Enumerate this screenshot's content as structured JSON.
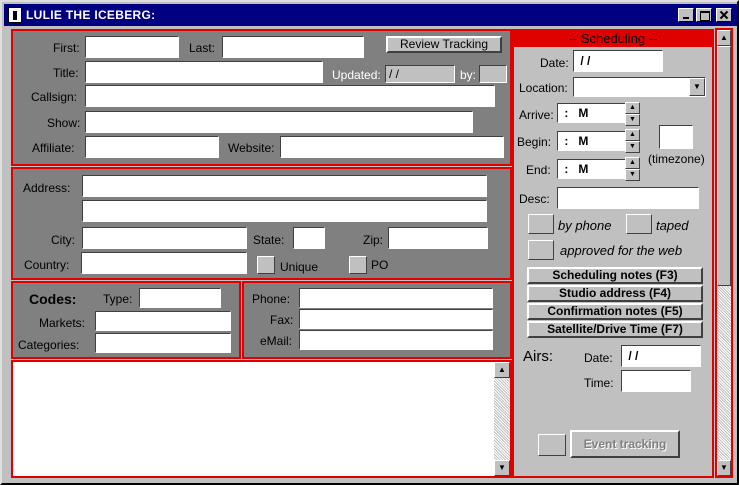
{
  "window": {
    "title": "LULIE THE ICEBERG:"
  },
  "contact": {
    "first_label": "First:",
    "first_value": "",
    "last_label": "Last:",
    "last_value": "",
    "review_button": "Review Tracking",
    "title_label": "Title:",
    "title_value": "",
    "updated_label": "Updated:",
    "updated_value": "/ /",
    "by_label": "by:",
    "by_value": "",
    "callsign_label": "Callsign:",
    "callsign_value": "",
    "show_label": "Show:",
    "show_value": "",
    "affiliate_label": "Affiliate:",
    "affiliate_value": "",
    "website_label": "Website:",
    "website_value": ""
  },
  "address": {
    "address_label": "Address:",
    "line1": "",
    "line2": "",
    "city_label": "City:",
    "city_value": "",
    "state_label": "State:",
    "state_value": "",
    "zip_label": "Zip:",
    "zip_value": "",
    "country_label": "Country:",
    "country_value": "",
    "unique_label": "Unique",
    "po_label": "PO"
  },
  "codes": {
    "heading": "Codes:",
    "type_label": "Type:",
    "type_value": "",
    "markets_label": "Markets:",
    "markets_value": "",
    "categories_label": "Categories:",
    "categories_value": ""
  },
  "phones": {
    "phone_label": "Phone:",
    "phone_value": "",
    "fax_label": "Fax:",
    "fax_value": "",
    "email_label": "eMail:",
    "email_value": ""
  },
  "notes": {
    "value": ""
  },
  "scheduling": {
    "header": "-- Scheduling --",
    "date_label": "Date:",
    "date_value": " / /",
    "location_label": "Location:",
    "location_value": "",
    "arrive_label": "Arrive:",
    "arrive_value": " :   M",
    "begin_label": "Begin:",
    "begin_value": " :   M",
    "end_label": "End:",
    "end_value": " :   M",
    "timezone_label": "(timezone)",
    "timezone_value": "",
    "desc_label": "Desc:",
    "desc_value": "",
    "by_phone_label": "by phone",
    "taped_label": "taped",
    "approved_label": "approved for the web",
    "btn_sched_notes": "Scheduling notes (F3)",
    "btn_studio": "Studio address (F4)",
    "btn_confirm": "Confirmation notes (F5)",
    "btn_satellite": "Satellite/Drive Time (F7)",
    "airs_label": "Airs:",
    "airs_date_label": "Date:",
    "airs_date_value": " / /",
    "airs_time_label": "Time:",
    "airs_time_value": "",
    "event_tracking_button": "Event tracking"
  },
  "colors": {
    "titlebar": "#000080",
    "panel": "#808080",
    "accent": "#e00000",
    "face": "#c0c0c0"
  }
}
